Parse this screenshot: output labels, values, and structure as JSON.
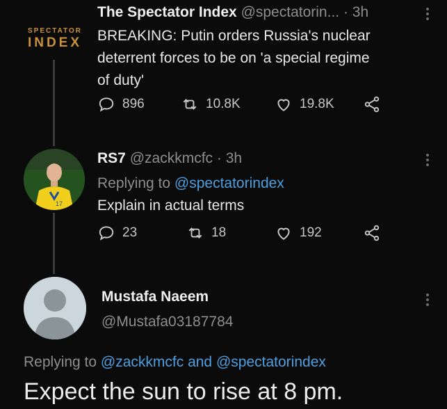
{
  "tweet1": {
    "logo_top": "SPECTATOR",
    "logo_bottom": "INDEX",
    "name": "The Spectator Index",
    "handle": "@spectatorin...",
    "time": "· 3h",
    "text_lines": [
      "BREAKING: Putin orders Russia's nuclear",
      "deterrent forces to be on 'a special regime",
      "of duty'"
    ],
    "replies": "896",
    "retweets": "10.8K",
    "likes": "19.8K"
  },
  "tweet2": {
    "name": "RS7",
    "handle": "@zackkmcfc",
    "time": "· 3h",
    "replying_prefix": "Replying to",
    "replying_to": "@spectatorindex",
    "text": "Explain in actual terms",
    "replies": "23",
    "retweets": "18",
    "likes": "192"
  },
  "tweet3": {
    "name": "Mustafa Naeem",
    "handle": "@Mustafa03187784",
    "replying_prefix": "Replying to",
    "replying_to_1": "@zackkmcfc",
    "replying_and": "and",
    "replying_to_2": "@spectatorindex",
    "text": "Expect the sun to rise at 8 pm."
  },
  "colors": {
    "background": "#0b0b0b",
    "link": "#4f9fe0",
    "logo": "#c9923a"
  },
  "icons": [
    "reply-icon",
    "retweet-icon",
    "like-icon",
    "share-icon",
    "more-icon"
  ]
}
